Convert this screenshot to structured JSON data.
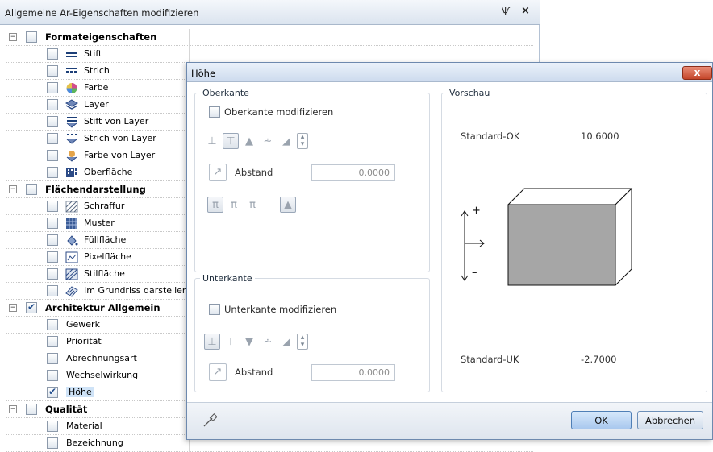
{
  "palette": {
    "title": "Allgemeine Ar-Eigenschaften modifizieren",
    "pin_glyph": "Ѱ",
    "close_glyph": "×",
    "rows": [
      {
        "kind": "group",
        "label": "Formateigenschaften",
        "checked": false,
        "expanded": true
      },
      {
        "kind": "item",
        "label": "Stift",
        "checked": false,
        "icon": "pen-icon"
      },
      {
        "kind": "item",
        "label": "Strich",
        "checked": false,
        "icon": "line-style-icon"
      },
      {
        "kind": "item",
        "label": "Farbe",
        "checked": false,
        "icon": "color-icon"
      },
      {
        "kind": "item",
        "label": "Layer",
        "checked": false,
        "icon": "layer-icon"
      },
      {
        "kind": "item",
        "label": "Stift von Layer",
        "checked": false,
        "icon": "pen-from-layer-icon"
      },
      {
        "kind": "item",
        "label": "Strich von Layer",
        "checked": false,
        "icon": "line-from-layer-icon"
      },
      {
        "kind": "item",
        "label": "Farbe von Layer",
        "checked": false,
        "icon": "color-from-layer-icon"
      },
      {
        "kind": "item",
        "label": "Oberfläche",
        "checked": false,
        "icon": "surface-icon"
      },
      {
        "kind": "group",
        "label": "Flächendarstellung",
        "checked": false,
        "expanded": true
      },
      {
        "kind": "item",
        "label": "Schraffur",
        "checked": false,
        "icon": "hatching-icon"
      },
      {
        "kind": "item",
        "label": "Muster",
        "checked": false,
        "icon": "pattern-icon"
      },
      {
        "kind": "item",
        "label": "Füllfläche",
        "checked": false,
        "icon": "fill-icon"
      },
      {
        "kind": "item",
        "label": "Pixelfläche",
        "checked": false,
        "icon": "pixel-surface-icon"
      },
      {
        "kind": "item",
        "label": "Stilfläche",
        "checked": false,
        "icon": "style-surface-icon"
      },
      {
        "kind": "item",
        "label": "Im Grundriss darstellen",
        "checked": false,
        "icon": "plan-view-icon"
      },
      {
        "kind": "group",
        "label": "Architektur Allgemein",
        "checked": true,
        "expanded": true
      },
      {
        "kind": "item",
        "label": "Gewerk",
        "checked": false,
        "icon": ""
      },
      {
        "kind": "item",
        "label": "Priorität",
        "checked": false,
        "icon": ""
      },
      {
        "kind": "item",
        "label": "Abrechnungsart",
        "checked": false,
        "icon": ""
      },
      {
        "kind": "item",
        "label": "Wechselwirkung",
        "checked": false,
        "icon": ""
      },
      {
        "kind": "item",
        "label": "Höhe",
        "checked": true,
        "icon": "",
        "selected": true
      },
      {
        "kind": "group",
        "label": "Qualität",
        "checked": false,
        "expanded": true
      },
      {
        "kind": "item",
        "label": "Material",
        "checked": false,
        "icon": ""
      },
      {
        "kind": "item",
        "label": "Bezeichnung",
        "checked": false,
        "icon": ""
      }
    ]
  },
  "dialog": {
    "title": "Höhe",
    "close_glyph": "x",
    "oberkante": {
      "legend": "Oberkante",
      "checkbox_label": "Oberkante modifizieren",
      "abstand_label": "Abstand",
      "abstand_value": "0.0000"
    },
    "unterkante": {
      "legend": "Unterkante",
      "checkbox_label": "Unterkante modifizieren",
      "abstand_label": "Abstand",
      "abstand_value": "0.0000"
    },
    "vorschau": {
      "legend": "Vorschau",
      "ok_label": "Standard-OK",
      "ok_value": "10.6000",
      "uk_label": "Standard-UK",
      "uk_value": "-2.7000",
      "plus": "+",
      "minus": "–"
    },
    "buttons": {
      "ok": "OK",
      "cancel": "Abbrechen"
    }
  },
  "colors": {
    "accent": "#6c8fb8",
    "close": "#c4462a",
    "preview_box": "#a6a6a6"
  }
}
